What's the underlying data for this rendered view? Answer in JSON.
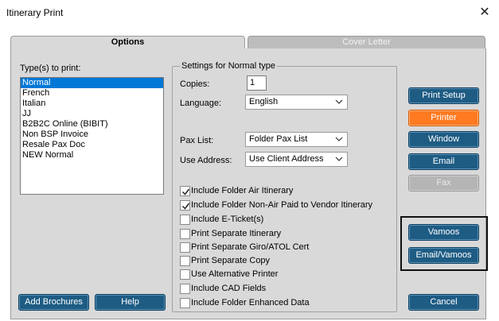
{
  "window": {
    "title": "Itinerary Print",
    "close_glyph": "✕"
  },
  "tabs": [
    {
      "label": "Options",
      "active": true
    },
    {
      "label": "Cover Letter",
      "active": false
    }
  ],
  "types": {
    "label": "Type(s) to print:",
    "items": [
      "Normal",
      "French",
      "Italian",
      "JJ",
      "B2B2C Online (BIBIT)",
      "Non BSP Invoice",
      "Resale Pax Doc",
      "NEW Normal"
    ],
    "selected_index": 0
  },
  "settings": {
    "title": "Settings for Normal type",
    "copies_label": "Copies:",
    "copies_value": "1",
    "language_label": "Language:",
    "language_value": "English",
    "pax_list_label": "Pax List:",
    "pax_list_value": "Folder Pax List",
    "use_address_label": "Use Address:",
    "use_address_value": "Use Client Address",
    "checkboxes": [
      {
        "label": "Include Folder Air Itinerary",
        "checked": true
      },
      {
        "label": "Include Folder Non-Air Paid to Vendor Itinerary",
        "checked": true
      },
      {
        "label": "Include E-Ticket(s)",
        "checked": false
      },
      {
        "label": "Print Separate Itinerary",
        "checked": false
      },
      {
        "label": "Print Separate Giro/ATOL Cert",
        "checked": false
      },
      {
        "label": "Print Separate Copy",
        "checked": false
      },
      {
        "label": "Use Alternative Printer",
        "checked": false
      },
      {
        "label": "Include CAD Fields",
        "checked": false
      },
      {
        "label": "Include Folder Enhanced Data",
        "checked": false
      }
    ]
  },
  "buttons": {
    "print_setup": "Print Setup",
    "printer": "Printer",
    "window": "Window",
    "email": "Email",
    "fax": "Fax",
    "vamoos": "Vamoos",
    "email_vamoos": "Email/Vamoos",
    "add_brochures": "Add Brochures",
    "help": "Help",
    "cancel": "Cancel"
  },
  "colors": {
    "button_blue": "#1e5c84",
    "button_orange": "#ff7a21",
    "button_disabled": "#b5b5b5",
    "selection": "#0078d7",
    "panel": "#d9d9d9"
  }
}
